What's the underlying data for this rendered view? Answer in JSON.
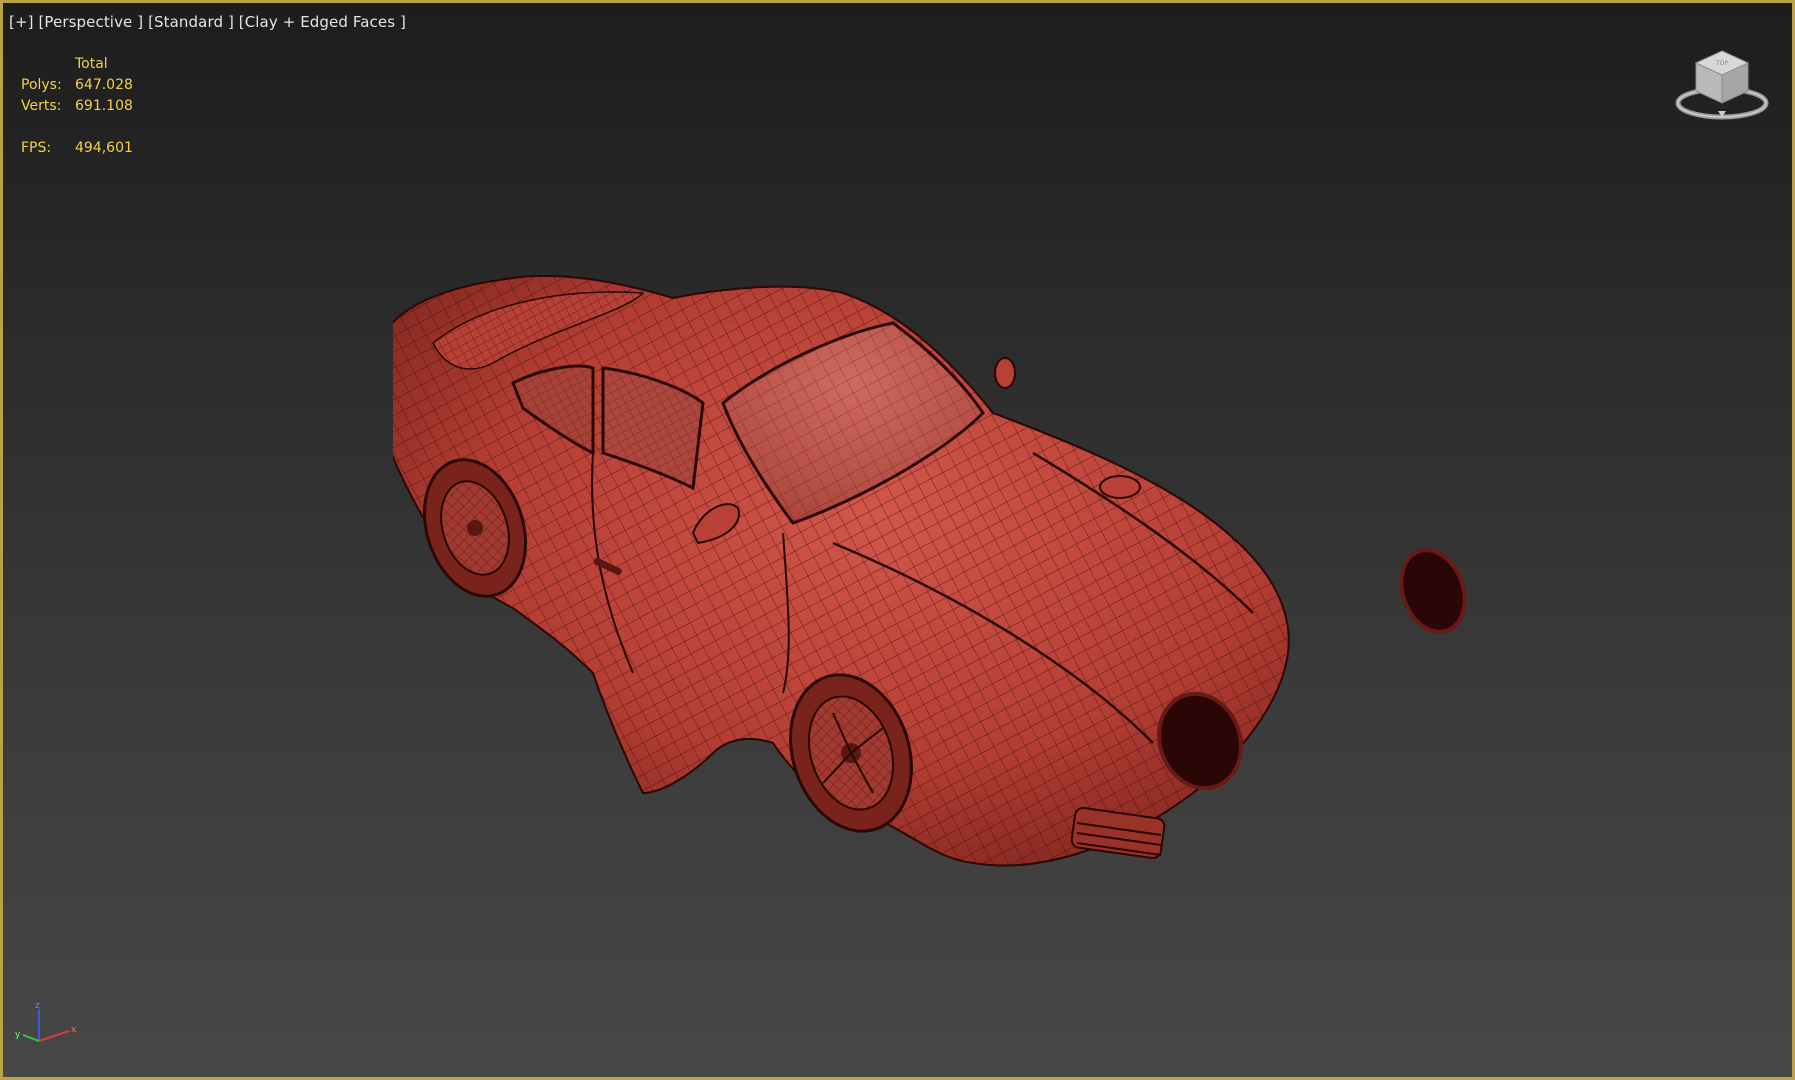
{
  "viewport": {
    "menu_plus": "[+]",
    "view_label": "[Perspective ]",
    "shading_label": "[Standard ]",
    "display_label": "[Clay + Edged Faces ]",
    "border_color": "#b8a24a"
  },
  "stats": {
    "header": "Total",
    "polys_label": "Polys:",
    "polys_value": "647.028",
    "verts_label": "Verts:",
    "verts_value": "691.108",
    "fps_label": "FPS:",
    "fps_value": "494,601",
    "text_color": "#f2d24a"
  },
  "viewcube": {
    "icon": "viewcube-icon"
  },
  "axis": {
    "x": "x",
    "y": "y",
    "z": "z"
  },
  "model": {
    "name": "sports-car-wireframe",
    "clay_color": "#c0443a",
    "edge_color": "#3a0c08"
  }
}
